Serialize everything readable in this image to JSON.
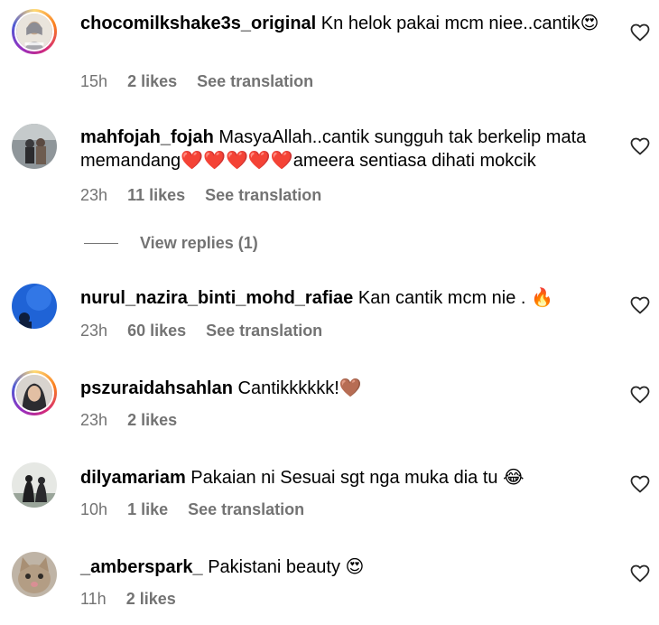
{
  "comments": [
    {
      "username": "chocomilkshake3s_original",
      "text": "Kn helok pakai mcm niee..cantik",
      "emoji": "😍",
      "time": "15h",
      "likes": "2 likes",
      "translation": "See translation"
    },
    {
      "username": "mahfojah_fojah",
      "text": "MasyaAllah..cantik sungguh tak berkelip mata memandang❤️❤️❤️❤️❤️ameera sentiasa dihati mokcik",
      "emoji": "",
      "time": "23h",
      "likes": "11 likes",
      "translation": "See translation",
      "view_replies": "View replies (1)"
    },
    {
      "username": "nurul_nazira_binti_mohd_rafiae",
      "text": "Kan cantik mcm nie .",
      "emoji": "🔥",
      "time": "23h",
      "likes": "60 likes",
      "translation": "See translation"
    },
    {
      "username": "pszuraidahsahlan",
      "text": "Cantikkkkkk!",
      "emoji": "🤎",
      "time": "23h",
      "likes": "2 likes",
      "translation": ""
    },
    {
      "username": "dilyamariam",
      "text": "Pakaian ni Sesuai sgt nga muka dia tu",
      "emoji": "😂",
      "time": "10h",
      "likes": "1 like",
      "translation": "See translation"
    },
    {
      "username": "_amberspark_",
      "text": "Pakistani beauty",
      "emoji": "😍",
      "time": "11h",
      "likes": "2 likes",
      "translation": ""
    }
  ],
  "icons": {
    "like": "heart-outline-icon"
  },
  "colors": {
    "text": "#000000",
    "secondary": "#737373",
    "story_ring": "#d62976"
  }
}
